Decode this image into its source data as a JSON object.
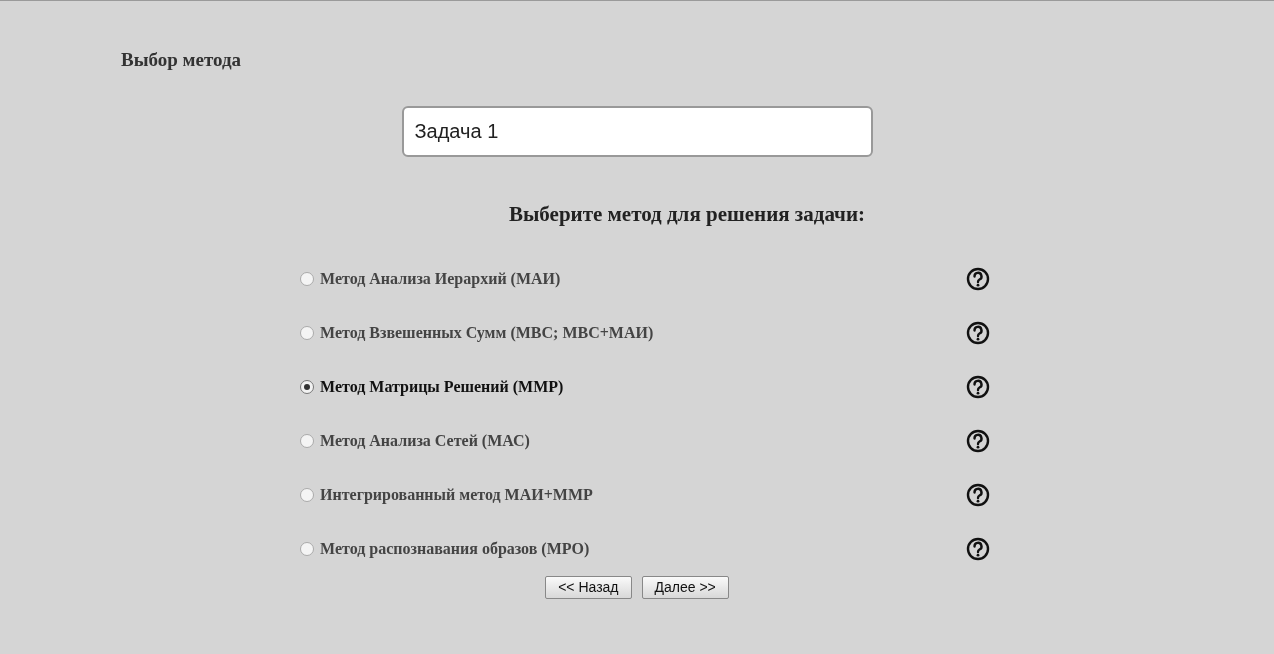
{
  "title": "Выбор метода",
  "task_field": {
    "value": "Задача 1"
  },
  "prompt": "Выберите метод для решения задачи:",
  "methods": [
    {
      "label": "Метод Анализа Иерархий (МАИ)",
      "selected": false
    },
    {
      "label": "Метод Взвешенных Сумм (МВС; МВС+МАИ)",
      "selected": false
    },
    {
      "label": "Метод Матрицы Решений (ММР)",
      "selected": true
    },
    {
      "label": "Метод Анализа Сетей (МАС)",
      "selected": false
    },
    {
      "label": "Интегрированный метод МАИ+ММР",
      "selected": false
    },
    {
      "label": "Метод распознавания образов (МРО)",
      "selected": false
    }
  ],
  "buttons": [
    "<< Назад",
    "Далее >>"
  ]
}
